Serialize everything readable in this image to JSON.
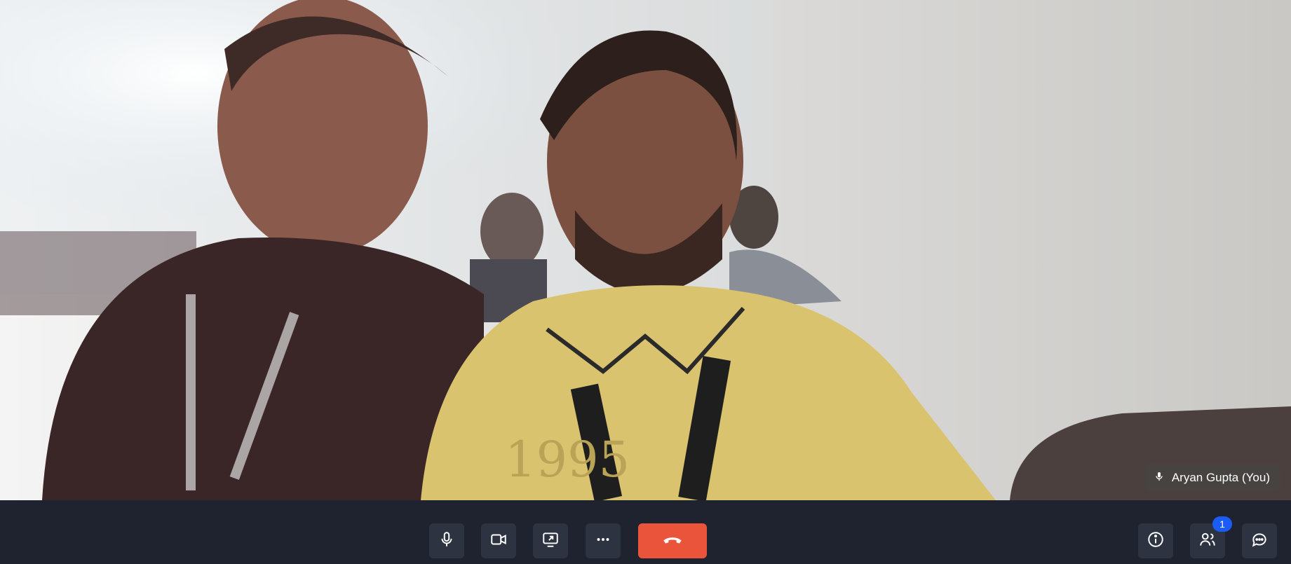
{
  "participant": {
    "name": "Aryan Gupta (You)",
    "mic_icon": "mic-icon"
  },
  "toolbar": {
    "mic_icon": "mic-icon",
    "camera_icon": "camera-icon",
    "share_screen_icon": "share-screen-icon",
    "more_icon": "more-icon",
    "end_call_icon": "phone-hangup-icon",
    "info_icon": "info-icon",
    "participants_icon": "people-icon",
    "participants_count": "1",
    "chat_icon": "chat-icon",
    "end_call_color": "#e9543a",
    "badge_color": "#1a5cf5"
  }
}
